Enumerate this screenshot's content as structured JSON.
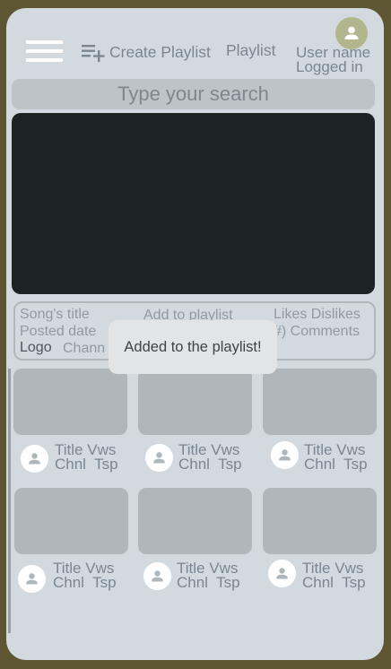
{
  "header": {
    "create_playlist_label": "Create Playlist",
    "playlist_label": "Playlist",
    "user_name_line1": "User name",
    "user_name_line2": "Logged in"
  },
  "search": {
    "placeholder": "Type your search"
  },
  "details": {
    "song_title": "Song's title",
    "posted_date": "Posted date",
    "logo": "Logo",
    "channel": "Chann",
    "add_to_playlist": "Add to playlist",
    "likes_dislikes": "Likes Dislikes",
    "comments": "#) Comments"
  },
  "toast": {
    "message": "Added to the playlist!"
  },
  "videos": [
    {
      "title": "Title",
      "views": "Vws",
      "channel": "Chnl",
      "timestamp": "Tsp"
    },
    {
      "title": "Title",
      "views": "Vws",
      "channel": "Chnl",
      "timestamp": "Tsp"
    },
    {
      "title": "Title",
      "views": "Vws",
      "channel": "Chnl",
      "timestamp": "Tsp"
    },
    {
      "title": "Title",
      "views": "Vws",
      "channel": "Chnl",
      "timestamp": "Tsp"
    },
    {
      "title": "Title",
      "views": "Vws",
      "channel": "Chnl",
      "timestamp": "Tsp"
    },
    {
      "title": "Title",
      "views": "Vws",
      "channel": "Chnl",
      "timestamp": "Tsp"
    }
  ],
  "colors": {
    "background": "#5e5533",
    "screen": "#d2dae0",
    "video_player": "#1b2422",
    "thumbnail": "#b0b7ba",
    "avatar": "#b3b68c"
  },
  "icons": [
    "menu-icon",
    "playlist-add-icon",
    "user-icon"
  ]
}
